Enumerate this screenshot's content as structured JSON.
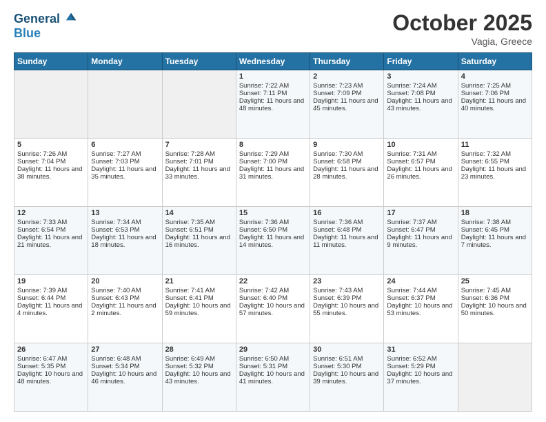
{
  "header": {
    "logo_line1": "General",
    "logo_line2": "Blue",
    "month": "October 2025",
    "location": "Vagia, Greece"
  },
  "weekdays": [
    "Sunday",
    "Monday",
    "Tuesday",
    "Wednesday",
    "Thursday",
    "Friday",
    "Saturday"
  ],
  "weeks": [
    [
      {
        "day": "",
        "content": ""
      },
      {
        "day": "",
        "content": ""
      },
      {
        "day": "",
        "content": ""
      },
      {
        "day": "1",
        "content": "Sunrise: 7:22 AM\nSunset: 7:11 PM\nDaylight: 11 hours and 48 minutes."
      },
      {
        "day": "2",
        "content": "Sunrise: 7:23 AM\nSunset: 7:09 PM\nDaylight: 11 hours and 45 minutes."
      },
      {
        "day": "3",
        "content": "Sunrise: 7:24 AM\nSunset: 7:08 PM\nDaylight: 11 hours and 43 minutes."
      },
      {
        "day": "4",
        "content": "Sunrise: 7:25 AM\nSunset: 7:06 PM\nDaylight: 11 hours and 40 minutes."
      }
    ],
    [
      {
        "day": "5",
        "content": "Sunrise: 7:26 AM\nSunset: 7:04 PM\nDaylight: 11 hours and 38 minutes."
      },
      {
        "day": "6",
        "content": "Sunrise: 7:27 AM\nSunset: 7:03 PM\nDaylight: 11 hours and 35 minutes."
      },
      {
        "day": "7",
        "content": "Sunrise: 7:28 AM\nSunset: 7:01 PM\nDaylight: 11 hours and 33 minutes."
      },
      {
        "day": "8",
        "content": "Sunrise: 7:29 AM\nSunset: 7:00 PM\nDaylight: 11 hours and 31 minutes."
      },
      {
        "day": "9",
        "content": "Sunrise: 7:30 AM\nSunset: 6:58 PM\nDaylight: 11 hours and 28 minutes."
      },
      {
        "day": "10",
        "content": "Sunrise: 7:31 AM\nSunset: 6:57 PM\nDaylight: 11 hours and 26 minutes."
      },
      {
        "day": "11",
        "content": "Sunrise: 7:32 AM\nSunset: 6:55 PM\nDaylight: 11 hours and 23 minutes."
      }
    ],
    [
      {
        "day": "12",
        "content": "Sunrise: 7:33 AM\nSunset: 6:54 PM\nDaylight: 11 hours and 21 minutes."
      },
      {
        "day": "13",
        "content": "Sunrise: 7:34 AM\nSunset: 6:53 PM\nDaylight: 11 hours and 18 minutes."
      },
      {
        "day": "14",
        "content": "Sunrise: 7:35 AM\nSunset: 6:51 PM\nDaylight: 11 hours and 16 minutes."
      },
      {
        "day": "15",
        "content": "Sunrise: 7:36 AM\nSunset: 6:50 PM\nDaylight: 11 hours and 14 minutes."
      },
      {
        "day": "16",
        "content": "Sunrise: 7:36 AM\nSunset: 6:48 PM\nDaylight: 11 hours and 11 minutes."
      },
      {
        "day": "17",
        "content": "Sunrise: 7:37 AM\nSunset: 6:47 PM\nDaylight: 11 hours and 9 minutes."
      },
      {
        "day": "18",
        "content": "Sunrise: 7:38 AM\nSunset: 6:45 PM\nDaylight: 11 hours and 7 minutes."
      }
    ],
    [
      {
        "day": "19",
        "content": "Sunrise: 7:39 AM\nSunset: 6:44 PM\nDaylight: 11 hours and 4 minutes."
      },
      {
        "day": "20",
        "content": "Sunrise: 7:40 AM\nSunset: 6:43 PM\nDaylight: 11 hours and 2 minutes."
      },
      {
        "day": "21",
        "content": "Sunrise: 7:41 AM\nSunset: 6:41 PM\nDaylight: 10 hours and 59 minutes."
      },
      {
        "day": "22",
        "content": "Sunrise: 7:42 AM\nSunset: 6:40 PM\nDaylight: 10 hours and 57 minutes."
      },
      {
        "day": "23",
        "content": "Sunrise: 7:43 AM\nSunset: 6:39 PM\nDaylight: 10 hours and 55 minutes."
      },
      {
        "day": "24",
        "content": "Sunrise: 7:44 AM\nSunset: 6:37 PM\nDaylight: 10 hours and 53 minutes."
      },
      {
        "day": "25",
        "content": "Sunrise: 7:45 AM\nSunset: 6:36 PM\nDaylight: 10 hours and 50 minutes."
      }
    ],
    [
      {
        "day": "26",
        "content": "Sunrise: 6:47 AM\nSunset: 5:35 PM\nDaylight: 10 hours and 48 minutes."
      },
      {
        "day": "27",
        "content": "Sunrise: 6:48 AM\nSunset: 5:34 PM\nDaylight: 10 hours and 46 minutes."
      },
      {
        "day": "28",
        "content": "Sunrise: 6:49 AM\nSunset: 5:32 PM\nDaylight: 10 hours and 43 minutes."
      },
      {
        "day": "29",
        "content": "Sunrise: 6:50 AM\nSunset: 5:31 PM\nDaylight: 10 hours and 41 minutes."
      },
      {
        "day": "30",
        "content": "Sunrise: 6:51 AM\nSunset: 5:30 PM\nDaylight: 10 hours and 39 minutes."
      },
      {
        "day": "31",
        "content": "Sunrise: 6:52 AM\nSunset: 5:29 PM\nDaylight: 10 hours and 37 minutes."
      },
      {
        "day": "",
        "content": ""
      }
    ]
  ]
}
